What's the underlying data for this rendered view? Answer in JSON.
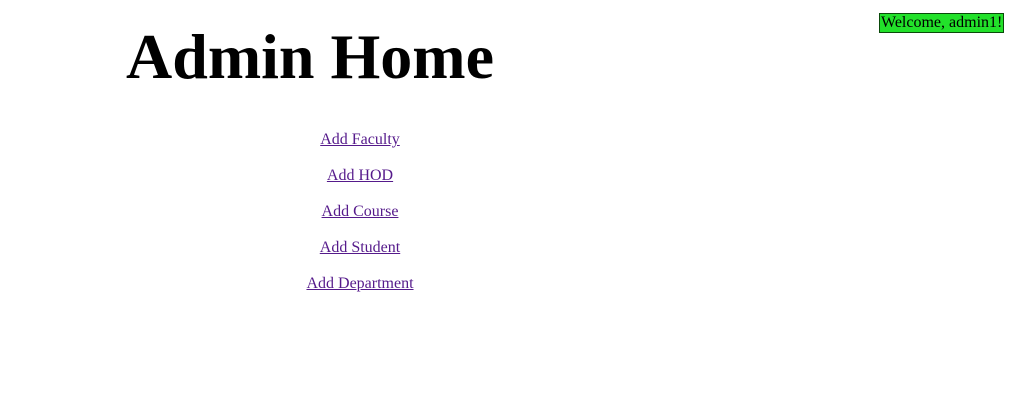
{
  "header": {
    "title": "Admin Home",
    "welcome_text": "Welcome, admin1!"
  },
  "colors": {
    "welcome_background": "#22e12a",
    "link_visited": "#551a8b"
  },
  "nav": {
    "links": [
      {
        "label": "Add Faculty"
      },
      {
        "label": "Add HOD"
      },
      {
        "label": "Add Course"
      },
      {
        "label": "Add Student"
      },
      {
        "label": "Add Department"
      }
    ]
  }
}
